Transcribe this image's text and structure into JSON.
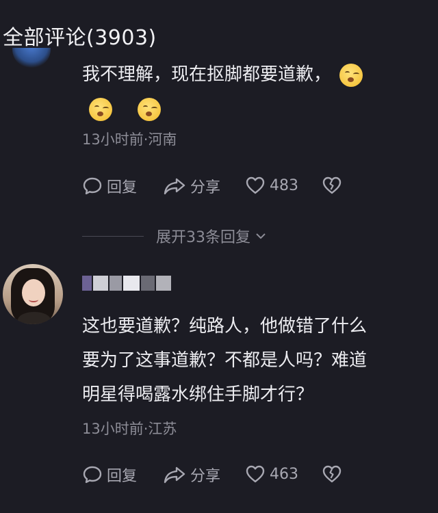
{
  "header": {
    "title": "全部评论(3903)"
  },
  "comment1": {
    "text_line1": "我不理解，现在抠脚都要道歉，",
    "meta": "13小时前·河南",
    "reply_label": "回复",
    "share_label": "分享",
    "likes": "483"
  },
  "expand": {
    "label": "展开33条回复"
  },
  "comment2": {
    "lines": [
      "这也要道歉？纯路人，他做错了什么",
      "要为了这事道歉？不都是人吗？难道",
      "明星得喝露水绑住手脚才行？"
    ],
    "meta": "13小时前·江苏",
    "reply_label": "回复",
    "share_label": "分享",
    "likes": "463"
  },
  "colors": {
    "background": "#1c1c24",
    "text": "#ececf0",
    "muted": "#8d8d97"
  }
}
